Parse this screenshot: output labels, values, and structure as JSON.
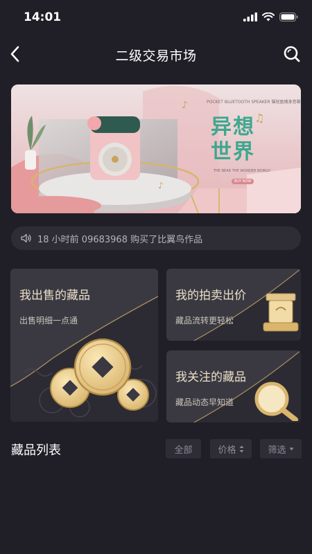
{
  "status_bar": {
    "time": "14:01"
  },
  "header": {
    "title": "二级交易市场"
  },
  "banner": {
    "brand_small": "POCKET BLUETOOTH SPEAKER 猫轻盈随身音箱",
    "title_line1": "异想",
    "title_line2": "世界",
    "subtitle": "THE BEAR THE WONDER WORLD",
    "pill": "BUY NOW"
  },
  "notice": {
    "text": "18 小时前 09683968 购买了比翼鸟作品"
  },
  "cards": {
    "sell": {
      "title": "我出售的藏品",
      "subtitle": "出售明细一点通"
    },
    "bid": {
      "title": "我的拍卖出价",
      "subtitle": "藏品流转更轻松"
    },
    "watch": {
      "title": "我关注的藏品",
      "subtitle": "藏品动态早知道"
    }
  },
  "list": {
    "title": "藏品列表",
    "filters": {
      "all": "全部",
      "price": "价格",
      "filter": "筛选"
    }
  },
  "colors": {
    "background": "#201f27",
    "card": "#3a3942",
    "gold": "#e2c68d",
    "accent_green": "#3fa78e"
  }
}
